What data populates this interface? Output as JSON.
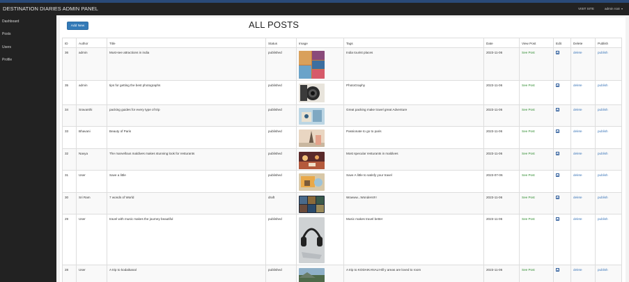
{
  "navbar": {
    "brand": "DESTINATION DIARIES ADMIN PANEL",
    "visit_site": "VISIT SITE",
    "user_menu": "admin root"
  },
  "sidebar": {
    "items": [
      {
        "label": "Dashboard"
      },
      {
        "label": "Posts"
      },
      {
        "label": "Users"
      },
      {
        "label": "Profile"
      }
    ]
  },
  "main": {
    "add_button": "Add New",
    "title": "ALL POSTS"
  },
  "table": {
    "headers": [
      "ID",
      "Author",
      "Title",
      "Status",
      "Image",
      "Tags",
      "Date",
      "View Post",
      "Edit",
      "Delete",
      "Publish"
    ],
    "rows": [
      {
        "id": "36",
        "author": "admin",
        "title": "Must-see attractions in india",
        "status": "published",
        "tags": "India tourist places",
        "date": "2023-11-06",
        "view": "See Post",
        "delete": "delete",
        "publish": "publish"
      },
      {
        "id": "35",
        "author": "admin",
        "title": "tips for getting the best photographs",
        "status": "published",
        "tags": "PhotoGraphy",
        "date": "2023-11-06",
        "view": "See Post",
        "delete": "delete",
        "publish": "publish"
      },
      {
        "id": "34",
        "author": "Sravanthi",
        "title": "packing guides for every type of trip",
        "status": "published",
        "tags": "Great packing make travel great Adventure",
        "date": "2023-11-06",
        "view": "See Post",
        "delete": "delete",
        "publish": "publish"
      },
      {
        "id": "33",
        "author": "Bhavani",
        "title": "Beauty of Paris",
        "status": "published",
        "tags": "Passionate to go to paris",
        "date": "2023-11-06",
        "view": "See Post",
        "delete": "delete",
        "publish": "publish"
      },
      {
        "id": "32",
        "author": "Navya",
        "title": "The marvellous maldives makes stunning look for resturants",
        "status": "published",
        "tags": "Most specular resturants in maldives",
        "date": "2023-11-06",
        "view": "See Post",
        "delete": "delete",
        "publish": "publish"
      },
      {
        "id": "31",
        "author": "User",
        "title": "Save a little",
        "status": "published",
        "tags": "Save A little to satisfy your travel",
        "date": "2023-07-06",
        "view": "See Post",
        "delete": "delete",
        "publish": "publish"
      },
      {
        "id": "30",
        "author": "Sri Ram",
        "title": "7 wonds of World",
        "status": "draft",
        "tags": "Wowww...Wonders!!!!",
        "date": "2023-11-06",
        "view": "See Post",
        "delete": "delete",
        "publish": "publish"
      },
      {
        "id": "29",
        "author": "User",
        "title": "travel with music makes the journey beautiful",
        "status": "published",
        "tags": "Music makes travel better",
        "date": "2023-11-06",
        "view": "See Post",
        "delete": "delete",
        "publish": "publish"
      },
      {
        "id": "28",
        "author": "User",
        "title": "A trip to kodaikanal",
        "status": "published",
        "tags": "A trip to KODAIKANAL!Hill y areas are loved to room",
        "date": "2023-11-06",
        "view": "See Post",
        "delete": "delete",
        "publish": "publish"
      }
    ]
  },
  "colors": {
    "navbar_bg": "#222222",
    "accent_blue": "#337ab7",
    "link_green": "#2e8b2e",
    "link_blue": "#3a75b8"
  },
  "icons": {
    "edit": "edit-icon",
    "caret": "chevron-down-icon"
  }
}
